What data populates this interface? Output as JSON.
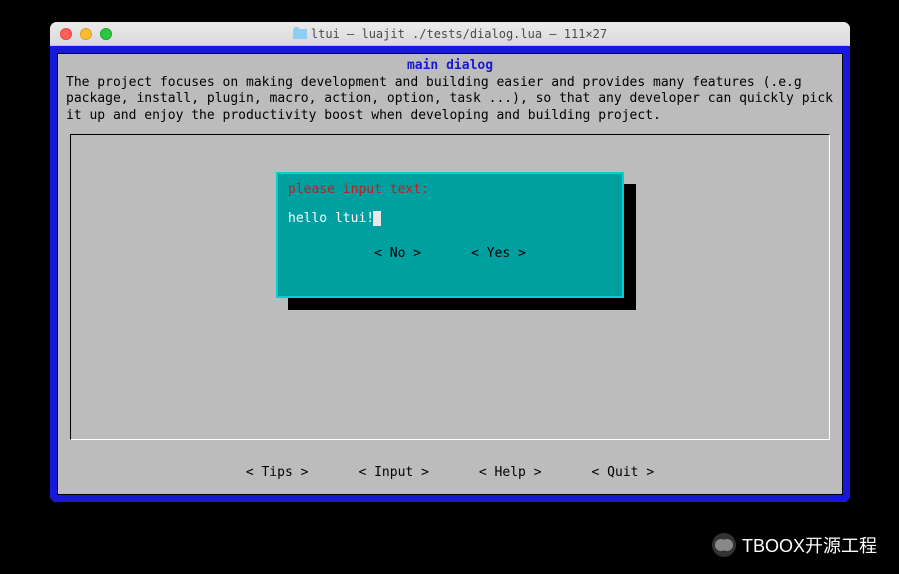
{
  "window": {
    "title": "ltui — luajit ./tests/dialog.lua — 111×27"
  },
  "main": {
    "title": "main dialog",
    "description": "The project focuses on making development and building easier and provides many features (.e.g package, install, plugin, macro, action, option, task ...), so that any developer can quickly pick it up and enjoy the productivity boost when developing and building project."
  },
  "footer": {
    "tips": "< Tips >",
    "input": "< Input >",
    "help": "< Help >",
    "quit": "< Quit >"
  },
  "dialog": {
    "prompt": "please input text:",
    "input_value": "hello ltui!",
    "no": "< No >",
    "yes": "< Yes >"
  },
  "watermark": {
    "text": "TBOOX开源工程"
  }
}
